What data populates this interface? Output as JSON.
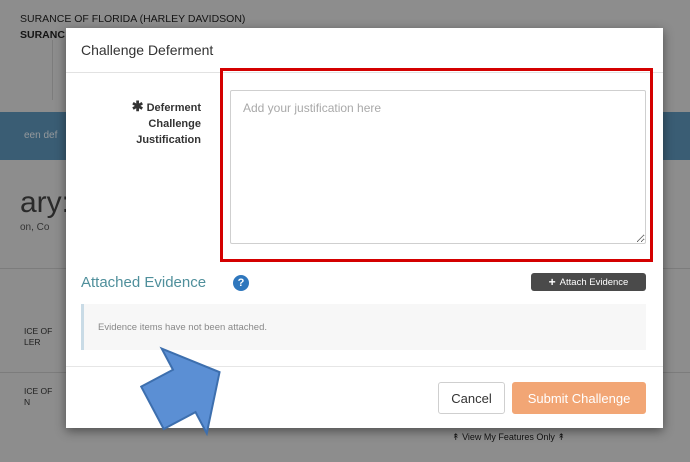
{
  "background": {
    "header_line1": "SURANCE OF FLORIDA  (HARLEY DAVIDSON)",
    "header_line2": "SURANC",
    "band_fragment": "een def",
    "big_fragment": "ary: 2",
    "small_fragment": "on, Co",
    "row1_line1": "ICE OF",
    "row1_line2": "LER",
    "row2_line1": "ICE OF",
    "row2_line2": "N",
    "features_link": "View My Features Only"
  },
  "modal": {
    "title": "Challenge Deferment",
    "field_label": "Deferment Challenge Justification",
    "required_marker": "✱",
    "justification_placeholder": "Add your justification here",
    "justification_value": "",
    "evidence_title": "Attached Evidence",
    "help_icon_glyph": "?",
    "attach_button_label": "Attach Evidence",
    "attach_button_icon": "+",
    "evidence_empty_text": "Evidence items have not been attached.",
    "cancel_label": "Cancel",
    "submit_label": "Submit Challenge"
  },
  "colors": {
    "highlight_box": "#d40000",
    "submit_button": "#f2a675",
    "evidence_title": "#4f8f9b",
    "help_icon": "#2f77bd",
    "annotation_arrow": "#5b8fd4"
  }
}
